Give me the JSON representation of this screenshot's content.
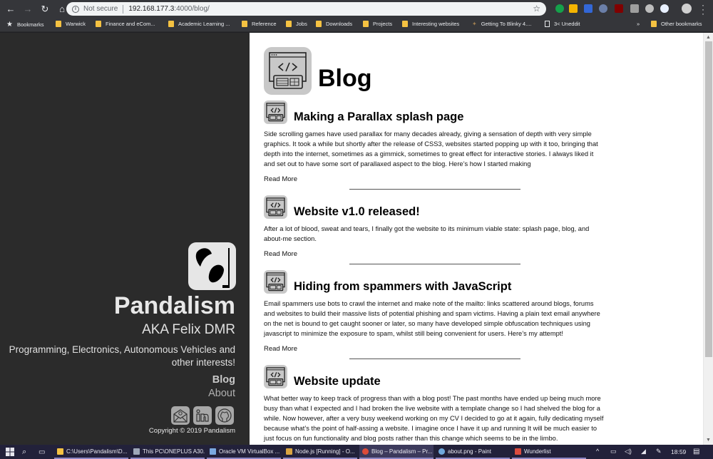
{
  "browser": {
    "nav": {
      "back": "←",
      "forward": "→",
      "reload": "↻",
      "home": "⌂"
    },
    "address": {
      "security_label": "Not secure",
      "host": "192.168.177.3",
      "path": ":4000/blog/"
    },
    "extensions": [
      {
        "name": "grammarly-extension",
        "color": "#15a14b"
      },
      {
        "name": "keep-extension",
        "color": "#f4b400"
      },
      {
        "name": "calendar-extension",
        "color": "#3367d6"
      },
      {
        "name": "w-extension",
        "color": "#6b7fa8"
      },
      {
        "name": "ublock-extension",
        "color": "#800000",
        "badge": "1"
      },
      {
        "name": "grey-extension",
        "color": "#9e9e9e"
      },
      {
        "name": "check-extension",
        "color": "#bdbdbd"
      },
      {
        "name": "globe-extension",
        "color": "#e8f0fe"
      }
    ],
    "bookmarks": [
      {
        "label": "Bookmarks",
        "icon": "star-icon"
      },
      {
        "label": "Warwick",
        "icon": "folder-icon"
      },
      {
        "label": "Finance and eCom...",
        "icon": "folder-icon"
      },
      {
        "label": "Academic Learning ...",
        "icon": "folder-icon"
      },
      {
        "label": "Reference",
        "icon": "folder-icon"
      },
      {
        "label": "Jobs",
        "icon": "folder-icon"
      },
      {
        "label": "Downloads",
        "icon": "folder-icon"
      },
      {
        "label": "Projects",
        "icon": "folder-icon"
      },
      {
        "label": "Interesting websites",
        "icon": "folder-icon"
      },
      {
        "label": "Getting To Blinky 4....",
        "icon": "page-icon"
      },
      {
        "label": "3< Uneddit",
        "icon": "doc-icon"
      }
    ],
    "bookmarks_overflow": "»",
    "other_bookmarks": "Other bookmarks"
  },
  "sidebar": {
    "name": "Pandalism",
    "aka": "AKA Felix DMR",
    "tagline": "Programming, Electronics, Autonomous Vehicles and other interests!",
    "nav": {
      "blog": "Blog",
      "about": "About"
    },
    "social": [
      "email",
      "linkedin",
      "github"
    ],
    "copyright": "Copyright © 2019 Pandalism"
  },
  "main": {
    "title": "Blog",
    "read_more_label": "Read More",
    "posts": [
      {
        "title": "Making a Parallax splash page",
        "excerpt": "Side scrolling games have used parallax for many decades already, giving a sensation of depth with very simple graphics. It took a while but shortly after the release of CSS3, websites started popping up with it too, bringing that depth into the internet, sometimes as a gimmick, sometimes to great effect for interactive stories. I always liked it and set out to have some sort of parallaxed aspect to the blog. Here’s how I started making"
      },
      {
        "title": "Website v1.0 released!",
        "excerpt": "After a lot of blood, sweat and tears, I finally got the website to its minimum viable state: splash page, blog, and about-me section."
      },
      {
        "title": "Hiding from spammers with JavaScript",
        "excerpt": "Email spammers use bots to crawl the internet and make note of the mailto: links scattered around blogs, forums and websites to build their massive lists of potential phishing and spam victims. Having a plain text email anywhere on the net is bound to get caught sooner or later, so many have developed simple obfuscation techniques using javascript to minimize the exposure to spam, whilst still being convenient for users. Here’s my attempt!"
      },
      {
        "title": "Website update",
        "excerpt": "What better way to keep track of progress than with a blog post! The past months have ended up being much more busy than what I expected and I had broken the live website with a template change so I had shelved the blog for a while. Now however, after a very busy weekend working on my CV I decided to go at it again, fully dedicating myself because what’s the point of half-assing a website. I imagine once I have it up and running It will be much easier to just focus on fun functionality and blog posts rather than this change which seems to be in the limbo."
      }
    ]
  },
  "scrollbar": {
    "visible_fraction": 0.8,
    "scroll_position": 0.0
  },
  "taskbar": {
    "apps": [
      {
        "label": "C:\\Users\\Pandalism\\D...",
        "icon": "folder-icon",
        "color": "#f5c242",
        "active": false
      },
      {
        "label": "This PC\\ONEPLUS A30...",
        "icon": "phone-icon",
        "color": "#9ea7b8",
        "active": false
      },
      {
        "label": "Oracle VM VirtualBox ...",
        "icon": "virtualbox-icon",
        "color": "#7aa9e0",
        "active": false
      },
      {
        "label": "Node.js [Running] - O...",
        "icon": "nodejs-icon",
        "color": "#d9a441",
        "active": false
      },
      {
        "label": "Blog – Pandalism – Pr...",
        "icon": "chrome-icon",
        "color": "#dd4b39",
        "active": true
      },
      {
        "label": "about.png - Paint",
        "icon": "paint-icon",
        "color": "#6fa8dc",
        "active": false
      },
      {
        "label": "Wunderlist",
        "icon": "wunderlist-icon",
        "color": "#db4c3f",
        "active": false
      }
    ],
    "clock": "18:59"
  }
}
